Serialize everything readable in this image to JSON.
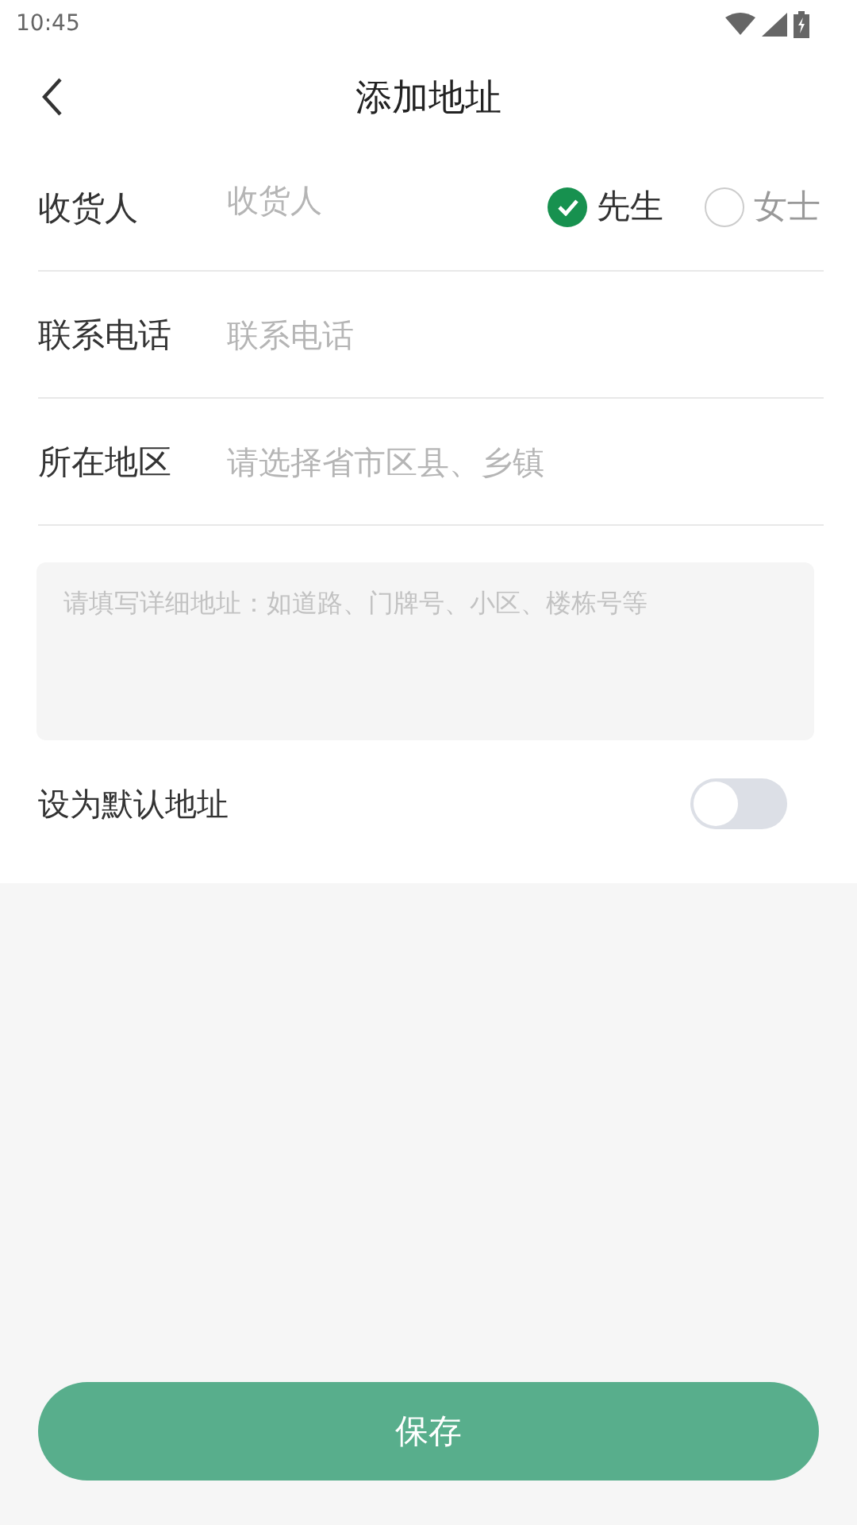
{
  "status_bar": {
    "time": "10:45"
  },
  "header": {
    "title": "添加地址"
  },
  "form": {
    "fields": [
      {
        "kind": "name",
        "label": "收货人",
        "placeholder": "收货人",
        "options": [
          {
            "label": "先生",
            "selected": true
          },
          {
            "label": "女士",
            "selected": false
          }
        ]
      },
      {
        "kind": "text",
        "label": "联系电话",
        "placeholder": "联系电话"
      },
      {
        "kind": "text",
        "label": "所在地区",
        "placeholder": "请选择省市区县、乡镇"
      }
    ],
    "detail": {
      "placeholder": "请填写详细地址：如道路、门牌号、小区、楼栋号等"
    },
    "default_address": {
      "label": "设为默认地址",
      "on": false
    }
  },
  "save_button": {
    "label": "保存"
  }
}
